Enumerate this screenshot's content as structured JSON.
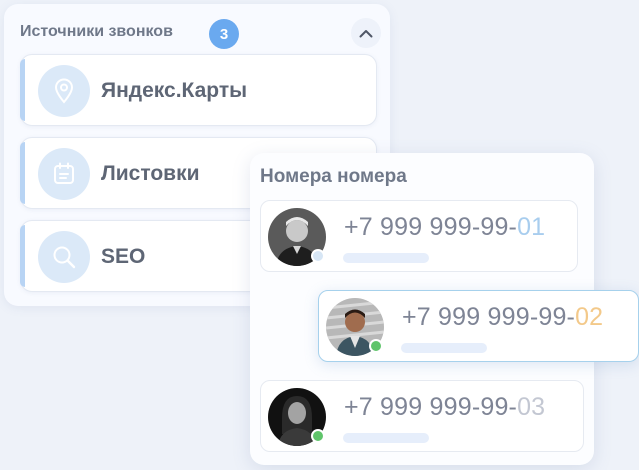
{
  "sources_panel": {
    "title": "Источники звонков",
    "count": "3",
    "collapse_icon": "chevron-up-icon",
    "items": [
      {
        "label": "Яндекс.Карты",
        "icon": "map-pin-icon"
      },
      {
        "label": "Листовки",
        "icon": "flyer-icon"
      },
      {
        "label": "SEO",
        "icon": "search-icon"
      }
    ]
  },
  "numbers_panel": {
    "title": "Номера номера",
    "items": [
      {
        "prefix": "+7 999 999-99-",
        "suffix": "01",
        "suffix_color": "#a8cdee",
        "status": "offline",
        "status_color": "#d7e6f5"
      },
      {
        "prefix": "+7 999 999-99-",
        "suffix": "02",
        "suffix_color": "#f3c98a",
        "status": "online",
        "status_color": "#5fc46a"
      },
      {
        "prefix": "+7 999 999-99-",
        "suffix": "03",
        "suffix_color": "#c3c7d2",
        "status": "online",
        "status_color": "#5fc46a"
      }
    ]
  },
  "colors": {
    "accent": "#6aa9ef",
    "badge_bg": "#6aa9ef",
    "card_accent": "#b8d4f4"
  }
}
